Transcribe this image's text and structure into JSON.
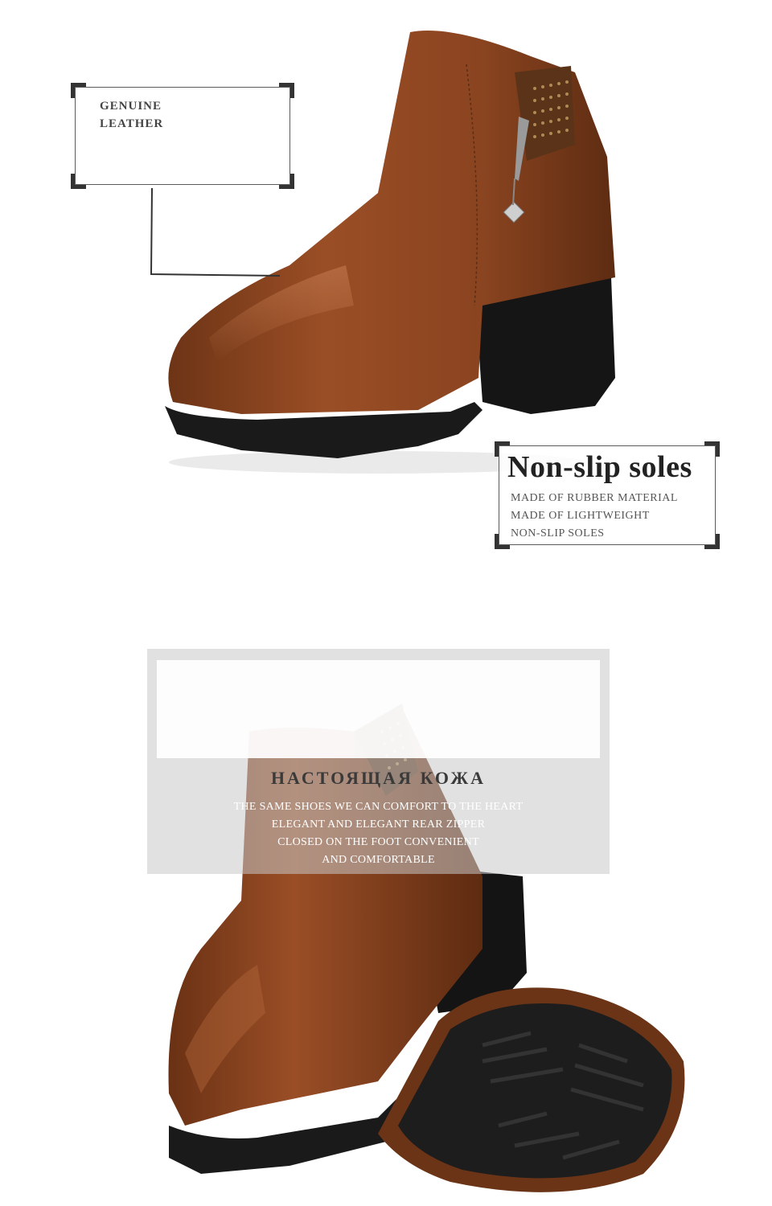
{
  "callouts": {
    "genuine_leather": {
      "line1": "GENUINE",
      "line2": "LEATHER"
    },
    "non_slip": {
      "title": "Non-slip soles",
      "lines": [
        "MADE OF RUBBER MATERIAL",
        "MADE OF LIGHTWEIGHT",
        "NON-SLIP SOLES"
      ]
    }
  },
  "banner": {
    "title": "НАСТОЯЩАЯ КОЖА",
    "lines": [
      "THE SAME SHOES WE CAN COMFORT  TO THE HEART",
      "ELEGANT AND ELEGANT REAR ZIPPER",
      "CLOSED ON THE FOOT CONVENIENT",
      "AND COMFORTABLE"
    ]
  },
  "colors": {
    "leather": "#8a4420",
    "sole": "#1a1a1a",
    "studs": "#b08a55"
  }
}
